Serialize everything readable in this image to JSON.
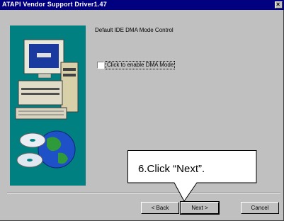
{
  "window": {
    "title": "ATAPI Vendor Support Driver1.47",
    "close_glyph": "×"
  },
  "illustration": {
    "icon": "computer-cd-globe-illustration"
  },
  "main": {
    "heading": "Default IDE DMA Mode Control",
    "checkbox": {
      "label": "Click to enable DMA Mode",
      "checked": false
    }
  },
  "buttons": {
    "back": "< Back",
    "next": "Next >",
    "cancel": "Cancel"
  },
  "callout": {
    "text": "6.Click “Next”."
  }
}
